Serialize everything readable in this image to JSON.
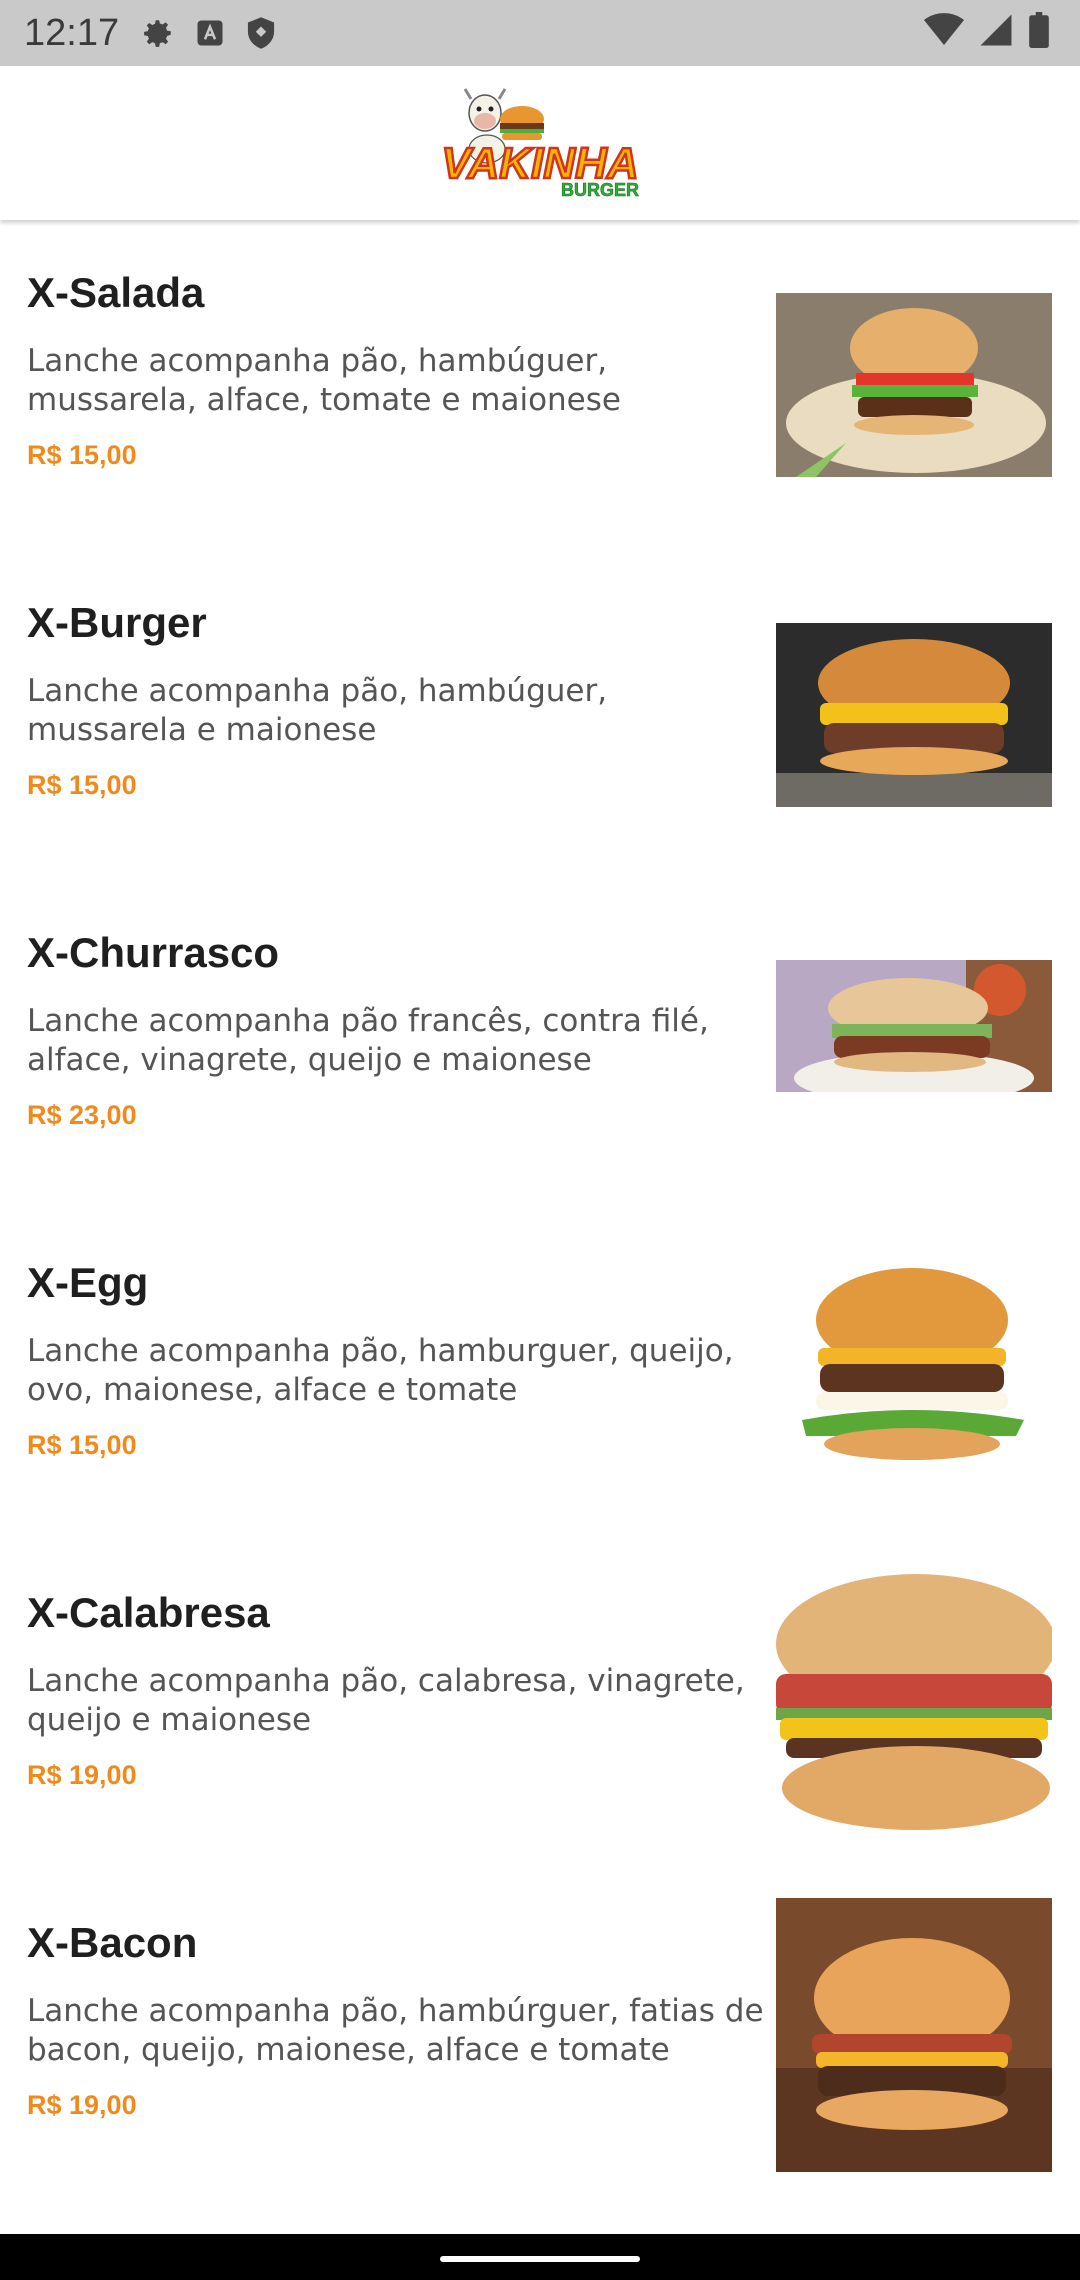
{
  "status_bar": {
    "time": "12:17",
    "left_icons": [
      "settings-icon",
      "text-a-icon",
      "shield-icon"
    ],
    "right_icons": [
      "wifi-icon",
      "signal-icon",
      "battery-icon"
    ]
  },
  "header": {
    "logo_text_main": "VAKINHA",
    "logo_text_sub": "BURGER",
    "colors": {
      "main_text": "#f5b400",
      "outline": "#d0351c",
      "sub_text": "#2fae3a"
    }
  },
  "products": [
    {
      "name": "X-Salada",
      "description": "Lanche acompanha pão, hambúguer, mussarela, alface, tomate e maionese",
      "price": "R$ 15,00",
      "image": "burger-salad-photo"
    },
    {
      "name": "X-Burger",
      "description": "Lanche acompanha pão, hambúguer, mussarela e maionese",
      "price": "R$ 15,00",
      "image": "burger-cheese-photo"
    },
    {
      "name": "X-Churrasco",
      "description": "Lanche acompanha pão francês, contra filé, alface, vinagrete, queijo e maionese",
      "price": "R$ 23,00",
      "image": "burger-churrasco-photo"
    },
    {
      "name": "X-Egg",
      "description": "Lanche acompanha pão, hamburguer, queijo, ovo, maionese, alface e tomate",
      "price": "R$ 15,00",
      "image": "burger-egg-photo"
    },
    {
      "name": "X-Calabresa",
      "description": "Lanche acompanha pão, calabresa, vinagrete, queijo e maionese",
      "price": "R$ 19,00",
      "image": "burger-calabresa-photo"
    },
    {
      "name": "X-Bacon",
      "description": "Lanche acompanha pão, hambúrguer, fatias de bacon, queijo, maionese, alface e tomate",
      "price": "R$ 19,00",
      "image": "burger-bacon-photo"
    }
  ],
  "theme": {
    "price_color": "#f08a1c",
    "title_color": "#1f1f1f"
  }
}
